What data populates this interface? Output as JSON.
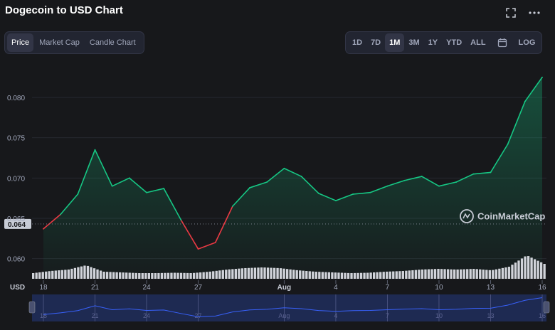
{
  "header": {
    "title": "Dogecoin to USD Chart",
    "fullscreen_icon": "fullscreen-icon",
    "more_icon": "more-icon"
  },
  "chart_types": [
    {
      "label": "Price",
      "active": true
    },
    {
      "label": "Market Cap",
      "active": false
    },
    {
      "label": "Candle Chart",
      "active": false
    }
  ],
  "ranges": [
    {
      "label": "1D",
      "active": false
    },
    {
      "label": "7D",
      "active": false
    },
    {
      "label": "1M",
      "active": true
    },
    {
      "label": "3M",
      "active": false
    },
    {
      "label": "1Y",
      "active": false
    },
    {
      "label": "YTD",
      "active": false
    },
    {
      "label": "ALL",
      "active": false
    }
  ],
  "calendar_icon": "calendar-icon",
  "log_label": "LOG",
  "watermark": "CoinMarketCap",
  "currency_label": "USD",
  "colors": {
    "up": "#16c784",
    "down": "#ea3943",
    "background": "#17181b",
    "navigator": "#1e2a52",
    "navigator_line": "#3861fb"
  },
  "chart_data": {
    "type": "area",
    "x": [
      "18",
      "19",
      "20",
      "21",
      "22",
      "23",
      "24",
      "25",
      "26",
      "27",
      "28",
      "29",
      "30",
      "31",
      "Aug",
      "2",
      "3",
      "4",
      "5",
      "6",
      "7",
      "8",
      "9",
      "10",
      "11",
      "12",
      "13",
      "14",
      "15",
      "16"
    ],
    "values": [
      0.0637,
      0.0655,
      0.068,
      0.0735,
      0.069,
      0.07,
      0.0682,
      0.0687,
      0.0648,
      0.0612,
      0.062,
      0.0665,
      0.0688,
      0.0695,
      0.0712,
      0.0702,
      0.0681,
      0.0672,
      0.068,
      0.0682,
      0.069,
      0.0697,
      0.0702,
      0.069,
      0.0695,
      0.0705,
      0.0707,
      0.0742,
      0.0795,
      0.0825
    ],
    "volume": [
      0.16,
      0.22,
      0.26,
      0.38,
      0.2,
      0.18,
      0.16,
      0.16,
      0.17,
      0.16,
      0.2,
      0.26,
      0.3,
      0.32,
      0.3,
      0.24,
      0.2,
      0.18,
      0.16,
      0.17,
      0.2,
      0.22,
      0.26,
      0.28,
      0.26,
      0.28,
      0.24,
      0.34,
      0.66,
      0.42
    ],
    "x_ticks": [
      "18",
      "21",
      "24",
      "27",
      "Aug",
      "4",
      "7",
      "10",
      "13",
      "16"
    ],
    "y_ticks": [
      "0.060",
      "0.065",
      "0.070",
      "0.075",
      "0.080"
    ],
    "ylim": [
      0.0575,
      0.0845
    ],
    "current_price_label": "0.064",
    "current_price": 0.0643,
    "grid": true,
    "ylabel": "",
    "xlabel": ""
  }
}
